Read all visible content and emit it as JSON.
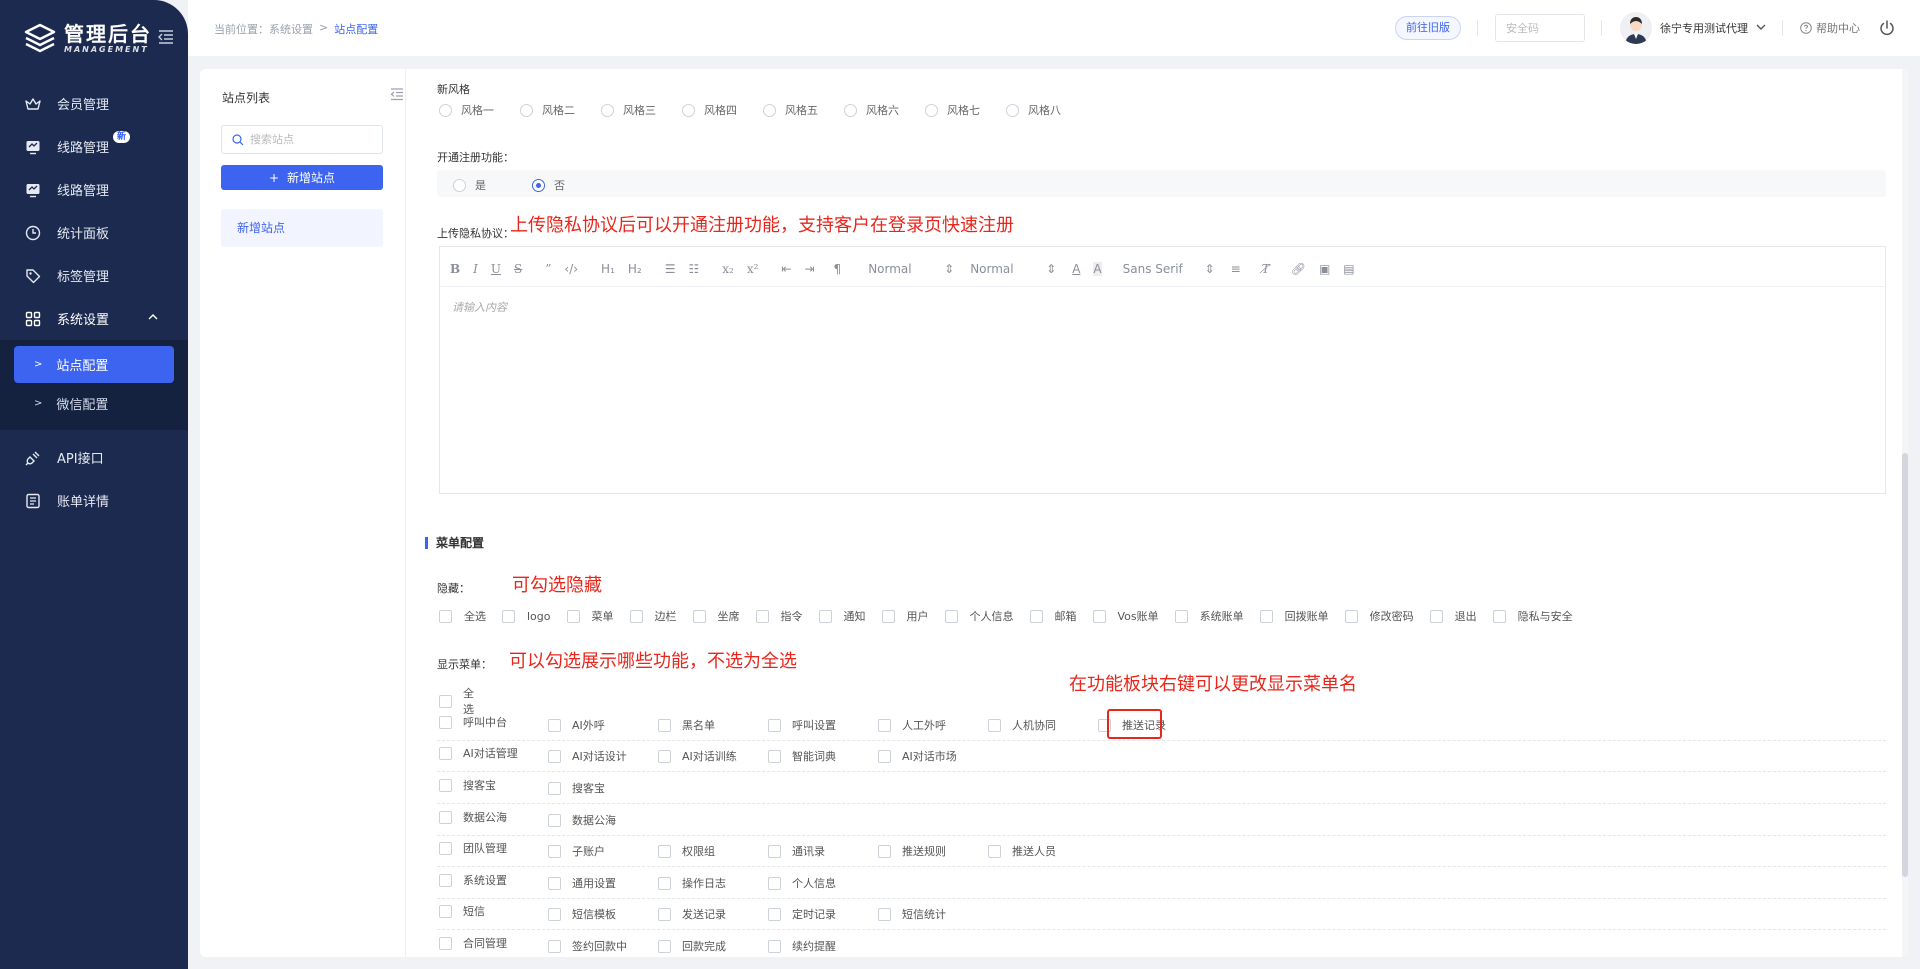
{
  "brand": {
    "title": "管理后台",
    "subtitle": "MANAGEMENT"
  },
  "nav": {
    "items": [
      {
        "label": "会员管理",
        "icon": "crown-icon"
      },
      {
        "label": "线路管理",
        "icon": "monitor-icon",
        "badge": "新"
      },
      {
        "label": "线路管理",
        "icon": "monitor-icon"
      },
      {
        "label": "统计面板",
        "icon": "clock-icon"
      },
      {
        "label": "标签管理",
        "icon": "tag-icon"
      },
      {
        "label": "系统设置",
        "icon": "grid-icon",
        "expanded": true
      }
    ],
    "sub": [
      {
        "label": "站点配置",
        "active": true
      },
      {
        "label": "微信配置",
        "active": false
      }
    ],
    "after": [
      {
        "label": "API接口",
        "icon": "plug-icon"
      },
      {
        "label": "账单详情",
        "icon": "bill-icon"
      }
    ]
  },
  "header": {
    "breadcrumb_prefix": "当前位置：",
    "breadcrumb_1": "系统设置",
    "breadcrumb_sep": ">",
    "breadcrumb_2": "站点配置",
    "old_version": "前往旧版",
    "security_placeholder": "安全码",
    "user_name": "徐宁专用测试代理",
    "help": "帮助中心"
  },
  "site_list": {
    "title": "站点列表",
    "search_placeholder": "搜索站点",
    "add_label": "新增站点",
    "add_prefix": "+",
    "entries": [
      "新增站点"
    ]
  },
  "form": {
    "style_label": "新风格",
    "styles": [
      "风格一",
      "风格二",
      "风格三",
      "风格四",
      "风格五",
      "风格六",
      "风格七",
      "风格八"
    ],
    "register_label": "开通注册功能：",
    "register_options": [
      "是",
      "否"
    ],
    "register_selected": 1,
    "privacy_label": "上传隐私协议：",
    "privacy_annotation": "上传隐私协议后可以开通注册功能，支持客户在登录页快速注册",
    "editor_placeholder": "请输入内容",
    "editor_toolbar": {
      "header_select": "Normal",
      "size_select": "Normal",
      "font_select": "Sans Serif"
    }
  },
  "menu_config": {
    "title": "菜单配置",
    "hide_label": "隐藏：",
    "hide_annotation": "可勾选隐藏",
    "hide_items": [
      "全选",
      "logo",
      "菜单",
      "边栏",
      "坐席",
      "指令",
      "通知",
      "用户",
      "个人信息",
      "邮箱",
      "Vos账单",
      "系统账单",
      "回拨账单",
      "修改密码",
      "退出",
      "隐私与安全"
    ],
    "show_label": "显示菜单：",
    "show_annotation": "可以勾选展示哪些功能，不选为全选",
    "rename_annotation": "在功能板块右键可以更改显示菜单名",
    "select_all": "全选",
    "groups": [
      {
        "name": "呼叫中台",
        "items": [
          "AI外呼",
          "黑名单",
          "呼叫设置",
          "人工外呼",
          "人机协同",
          "推送记录"
        ]
      },
      {
        "name": "AI对话管理",
        "items": [
          "AI对话设计",
          "AI对话训练",
          "智能词典",
          "AI对话市场"
        ]
      },
      {
        "name": "搜客宝",
        "items": [
          "搜客宝"
        ]
      },
      {
        "name": "数据公海",
        "items": [
          "数据公海"
        ]
      },
      {
        "name": "团队管理",
        "items": [
          "子账户",
          "权限组",
          "通讯录",
          "推送规则",
          "推送人员"
        ]
      },
      {
        "name": "系统设置",
        "items": [
          "通用设置",
          "操作日志",
          "个人信息"
        ]
      },
      {
        "name": "短信",
        "items": [
          "短信模板",
          "发送记录",
          "定时记录",
          "短信统计"
        ]
      },
      {
        "name": "合同管理",
        "items": [
          "签约回款中",
          "回款完成",
          "续约提醒"
        ]
      }
    ]
  },
  "colors": {
    "primary": "#3d64f0",
    "sidebar": "#1b2a4e",
    "annotation": "#e8261c"
  }
}
